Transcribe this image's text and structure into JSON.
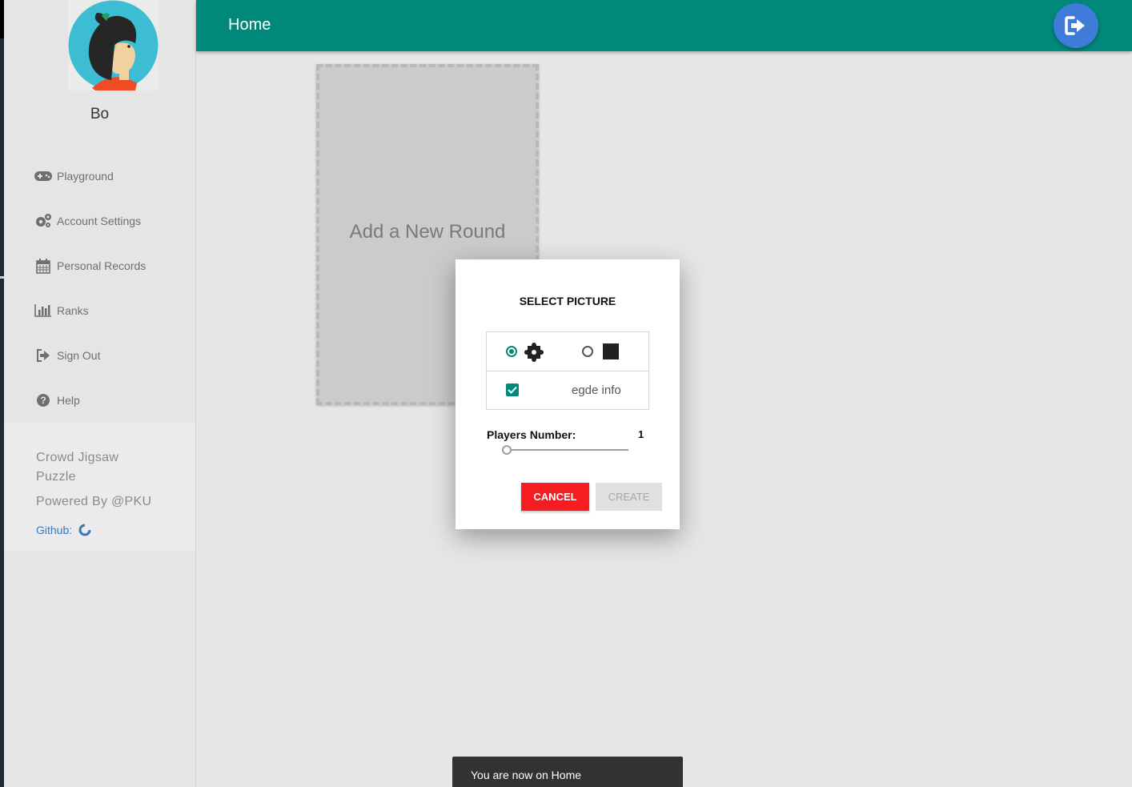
{
  "user": {
    "name": "Bo"
  },
  "sidebar": {
    "items": [
      {
        "label": "Playground",
        "icon": "gamepad-icon"
      },
      {
        "label": "Account Settings",
        "icon": "gears-icon"
      },
      {
        "label": "Personal Records",
        "icon": "calendar-icon"
      },
      {
        "label": "Ranks",
        "icon": "bar-chart-icon"
      },
      {
        "label": "Sign Out",
        "icon": "sign-out-icon"
      },
      {
        "label": "Help",
        "icon": "question-circle-icon"
      }
    ],
    "footer": {
      "title": "Crowd Jigsaw Puzzle",
      "powered": "Powered By @PKU",
      "github_label": "Github:"
    }
  },
  "header": {
    "title": "Home",
    "fab_icon": "sign-out-icon"
  },
  "main": {
    "card_label": "Add a New Round"
  },
  "dialog": {
    "title": "SELECT PICTURE",
    "options": [
      {
        "icon": "puzzle-piece-icon",
        "selected": true
      },
      {
        "icon": "square-icon",
        "selected": false
      }
    ],
    "edge_info": {
      "label": "egde info",
      "checked": true
    },
    "players": {
      "label": "Players Number:",
      "value": "1",
      "slider_fraction": 0
    },
    "cancel_label": "CANCEL",
    "create_label": "CREATE"
  },
  "toast": {
    "text": "You are now on Home"
  },
  "colors": {
    "primary": "#00897b",
    "fab": "#3f7bd9",
    "cancel": "#f51d22",
    "link": "#3b78b8"
  }
}
